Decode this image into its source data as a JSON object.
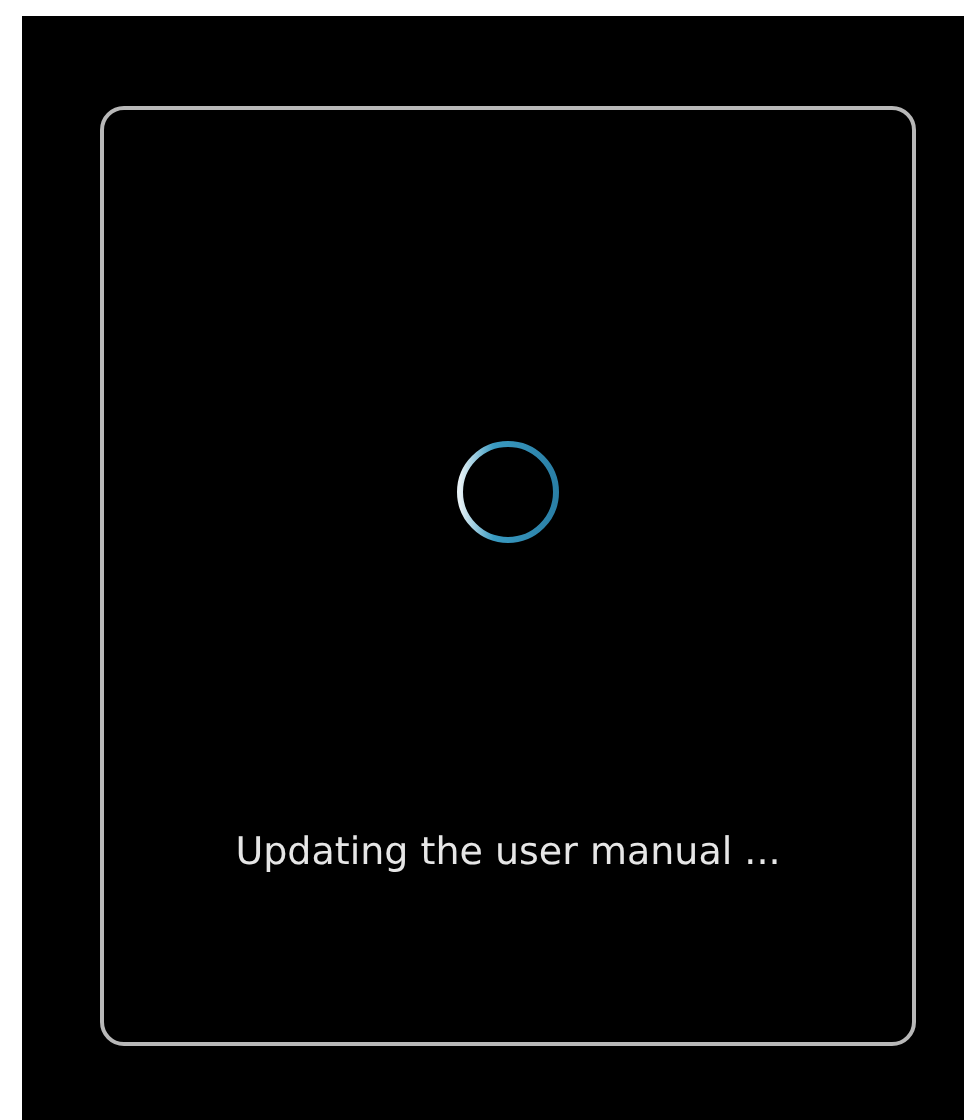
{
  "dialog": {
    "message": "Updating the user manual ..."
  }
}
